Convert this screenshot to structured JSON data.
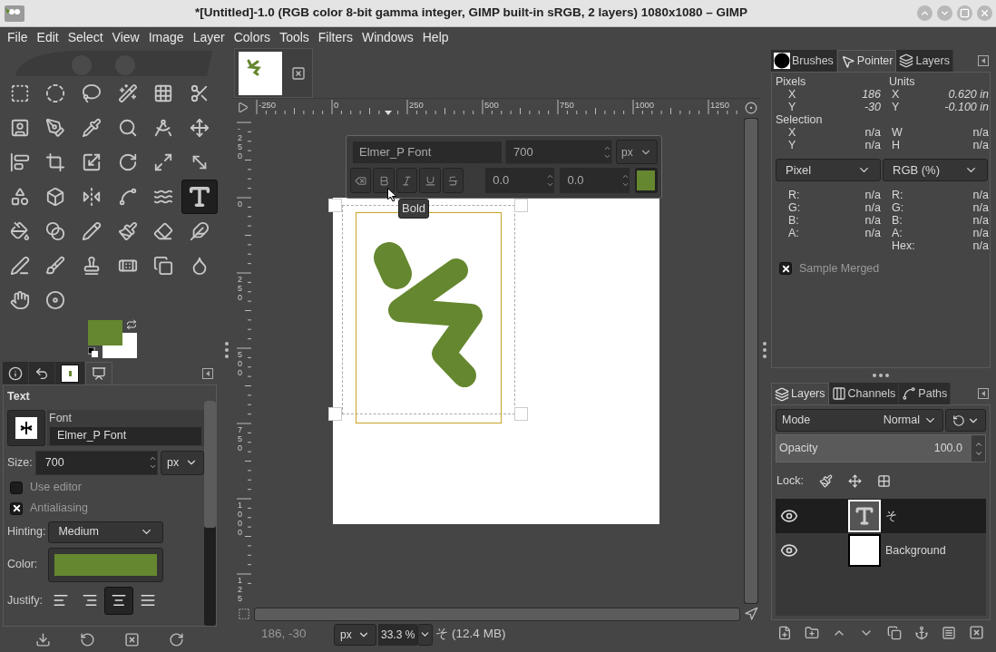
{
  "window": {
    "title": "*[Untitled]-1.0 (RGB color 8-bit gamma integer, GIMP built-in sRGB, 2 layers) 1080x1080 – GIMP"
  },
  "menu": [
    "File",
    "Edit",
    "Select",
    "View",
    "Image",
    "Layer",
    "Colors",
    "Tools",
    "Filters",
    "Windows",
    "Help"
  ],
  "toolbox": {
    "tools": [
      {
        "kind": "rect-select",
        "selected": false
      },
      {
        "kind": "ellipse-select",
        "selected": false
      },
      {
        "kind": "free-select",
        "selected": false
      },
      {
        "kind": "fuzzy-select",
        "selected": false
      },
      {
        "kind": "color-select",
        "selected": false
      },
      {
        "kind": "scissors-select",
        "selected": false
      },
      {
        "kind": "foreground-select",
        "selected": false
      },
      {
        "kind": "paths",
        "selected": false
      },
      {
        "kind": "color-picker",
        "selected": false
      },
      {
        "kind": "zoom",
        "selected": false
      },
      {
        "kind": "measure",
        "selected": false
      },
      {
        "kind": "move",
        "selected": false
      },
      {
        "kind": "align",
        "selected": false
      },
      {
        "kind": "crop",
        "selected": false
      },
      {
        "kind": "unified-transform",
        "selected": false
      },
      {
        "kind": "rotate",
        "selected": false
      },
      {
        "kind": "scale",
        "selected": false
      },
      {
        "kind": "shear",
        "selected": false
      },
      {
        "kind": "warp",
        "selected": false
      },
      {
        "kind": "perspective",
        "selected": false
      },
      {
        "kind": "flip",
        "selected": false
      },
      {
        "kind": "cage",
        "selected": false
      },
      {
        "kind": "wave",
        "selected": false
      },
      {
        "kind": "text",
        "selected": true
      },
      {
        "kind": "bucket-fill",
        "selected": false
      },
      {
        "kind": "gradient",
        "selected": false
      },
      {
        "kind": "pencil",
        "selected": false
      },
      {
        "kind": "paintbrush",
        "selected": false
      },
      {
        "kind": "eraser",
        "selected": false
      },
      {
        "kind": "airbrush",
        "selected": false
      },
      {
        "kind": "ink",
        "selected": false
      },
      {
        "kind": "mypaint",
        "selected": false
      },
      {
        "kind": "clone",
        "selected": false
      },
      {
        "kind": "heal",
        "selected": false
      },
      {
        "kind": "perspective-clone",
        "selected": false
      },
      {
        "kind": "blur",
        "selected": false
      },
      {
        "kind": "smudge",
        "selected": false
      },
      {
        "kind": "dodge-burn",
        "selected": false
      }
    ],
    "colors": [
      {
        "color": "#65872f"
      },
      {
        "color": "#ffffff"
      }
    ]
  },
  "tool_options": {
    "tabs": [
      {
        "kind": "tool-options",
        "selected": false
      },
      {
        "kind": "undo",
        "selected": false
      },
      {
        "kind": "image",
        "selected": false
      },
      {
        "kind": "device",
        "selected": true
      }
    ],
    "title": "Text",
    "font_label": "Font",
    "font": "Elmer_P Font",
    "size_label": "Size:",
    "size": "700",
    "size_unit": "px",
    "checkboxes": [
      {
        "label": "Use editor",
        "checked": false
      },
      {
        "label": "Antialiasing",
        "checked": true
      }
    ],
    "hinting_label": "Hinting:",
    "hinting": "Medium",
    "color_label": "Color:",
    "color": "#65872f",
    "justify_label": "Justify:",
    "justify": [
      {
        "kind": "left",
        "selected": false
      },
      {
        "kind": "right",
        "selected": false
      },
      {
        "kind": "center",
        "selected": true
      },
      {
        "kind": "fill",
        "selected": false
      }
    ]
  },
  "canvas": {
    "ruler_h": [
      "-250",
      "0",
      "250",
      "500",
      "750",
      "1000",
      "1250"
    ],
    "ruler_v": [
      "-250",
      "0",
      "250",
      "500",
      "750",
      "1000",
      "125"
    ],
    "glyph": {
      "color": "#65872f"
    },
    "editor": {
      "font": "Elmer_P Font",
      "size": "700",
      "unit": "px",
      "styles": [
        {
          "kind": "clear"
        },
        {
          "kind": "bold"
        },
        {
          "kind": "italic"
        },
        {
          "kind": "underline"
        },
        {
          "kind": "strikethrough"
        }
      ],
      "baseline": "0.0",
      "kerning": "0.0",
      "color": "#65872f"
    },
    "tooltip": "Bold"
  },
  "status": {
    "coords": "186, -30",
    "unit": "px",
    "zoom": "33.3 %",
    "info": "そ (12.4 MB)"
  },
  "pointer_dock": {
    "tabs": [
      {
        "label": "Brushes",
        "kind": "brushes",
        "selected": false
      },
      {
        "label": "Pointer",
        "kind": "pointer",
        "selected": true
      },
      {
        "label": "Layers",
        "kind": "layers",
        "selected": false
      }
    ],
    "pixels_label": "Pixels",
    "units_label": "Units",
    "pixel_rows": [
      {
        "left": "X",
        "left_value": "186",
        "right": "X",
        "right_value": "0.620 in"
      },
      {
        "left": "Y",
        "left_value": "-30",
        "right": "Y",
        "right_value": "-0.100 in"
      }
    ],
    "selection_label": "Selection",
    "selection_rows": [
      {
        "left": "X",
        "left_value": "n/a",
        "right": "W",
        "right_value": "n/a"
      },
      {
        "left": "Y",
        "left_value": "n/a",
        "right": "H",
        "right_value": "n/a"
      }
    ],
    "modes": [
      "Pixel",
      "RGB (%)"
    ],
    "color_rows": [
      {
        "left": "R:",
        "left_value": "n/a",
        "right": "R:",
        "right_value": "n/a"
      },
      {
        "left": "G:",
        "left_value": "n/a",
        "right": "G:",
        "right_value": "n/a"
      },
      {
        "left": "B:",
        "left_value": "n/a",
        "right": "B:",
        "right_value": "n/a"
      },
      {
        "left": "A:",
        "left_value": "n/a",
        "right": "A:",
        "right_value": "n/a"
      },
      {
        "right": "Hex:",
        "right_value": "n/a"
      }
    ],
    "sample_merged": {
      "label": "Sample Merged",
      "checked": true
    }
  },
  "layers_dock": {
    "tabs": [
      {
        "label": "Layers",
        "kind": "layers",
        "selected": true
      },
      {
        "label": "Channels",
        "kind": "channels",
        "selected": false
      },
      {
        "label": "Paths",
        "kind": "paths",
        "selected": false
      }
    ],
    "mode_label": "Mode",
    "mode": "Normal",
    "opacity": {
      "label": "Opacity",
      "value": "100.0"
    },
    "lock_label": "Lock:",
    "layers": [
      {
        "name": "そ",
        "kind": "text",
        "visible": true,
        "selected": true
      },
      {
        "name": "Background",
        "kind": "image",
        "visible": true,
        "selected": false
      }
    ]
  }
}
